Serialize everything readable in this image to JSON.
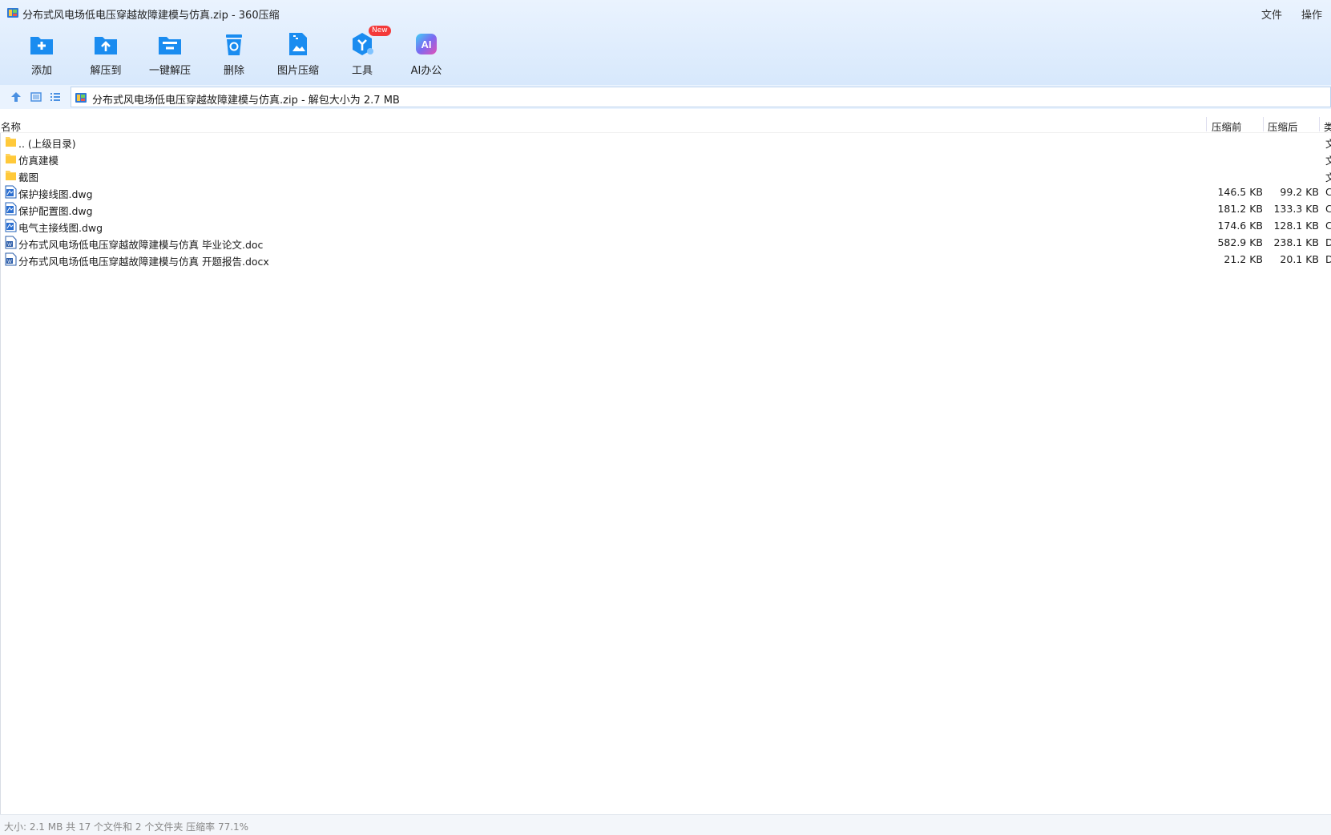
{
  "window": {
    "title": "分布式风电场低电压穿越故障建模与仿真.zip - 360压缩",
    "menu": [
      "文件",
      "操作"
    ]
  },
  "toolbar": {
    "items": [
      {
        "label": "添加",
        "icon": "add-icon"
      },
      {
        "label": "解压到",
        "icon": "extract-to-icon"
      },
      {
        "label": "一键解压",
        "icon": "one-click-extract-icon"
      },
      {
        "label": "删除",
        "icon": "delete-icon"
      },
      {
        "label": "图片压缩",
        "icon": "image-compress-icon"
      },
      {
        "label": "工具",
        "icon": "tools-icon",
        "badge": "New"
      },
      {
        "label": "AI办公",
        "icon": "ai-office-icon",
        "icon_text": "AI"
      }
    ]
  },
  "address": {
    "text": "分布式风电场低电压穿越故障建模与仿真.zip - 解包大小为 2.7 MB"
  },
  "columns": {
    "name": "名称",
    "before": "压缩前",
    "after": "压缩后",
    "type": "类"
  },
  "files": [
    {
      "name": ".. (上级目录)",
      "kind": "folder",
      "before": "",
      "after": "",
      "type": "文"
    },
    {
      "name": "仿真建模",
      "kind": "folder",
      "before": "",
      "after": "",
      "type": "文"
    },
    {
      "name": "截图",
      "kind": "folder",
      "before": "",
      "after": "",
      "type": "文"
    },
    {
      "name": "保护接线图.dwg",
      "kind": "dwg",
      "before": "146.5 KB",
      "after": "99.2 KB",
      "type": "C"
    },
    {
      "name": "保护配置图.dwg",
      "kind": "dwg",
      "before": "181.2 KB",
      "after": "133.3 KB",
      "type": "C"
    },
    {
      "name": "电气主接线图.dwg",
      "kind": "dwg",
      "before": "174.6 KB",
      "after": "128.1 KB",
      "type": "C"
    },
    {
      "name": "分布式风电场低电压穿越故障建模与仿真 毕业论文.doc",
      "kind": "doc",
      "before": "582.9 KB",
      "after": "238.1 KB",
      "type": "D"
    },
    {
      "name": "分布式风电场低电压穿越故障建模与仿真 开题报告.docx",
      "kind": "doc",
      "before": "21.2 KB",
      "after": "20.1 KB",
      "type": "D"
    }
  ],
  "status": {
    "text": "大小: 2.1 MB 共 17 个文件和 2 个文件夹 压缩率 77.1%"
  },
  "colors": {
    "accent": "#1a8cf0",
    "toolbar_bg": "#dceafc",
    "folder": "#ffd35c",
    "status_text": "#888888",
    "badge": "#f43a3a"
  }
}
